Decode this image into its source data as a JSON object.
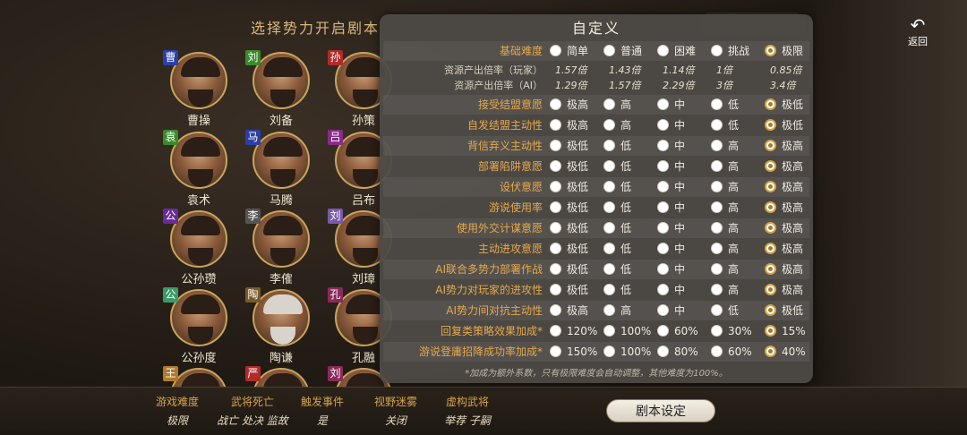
{
  "screen": {
    "title": "选择势力开启剧本",
    "back_label": "返回",
    "back_icon": "undo-arrow-icon"
  },
  "characters": [
    {
      "badge": "曹",
      "badge_color": "#2b3fa8",
      "name": "曹操",
      "hair": "dark"
    },
    {
      "badge": "刘",
      "badge_color": "#3a8a2a",
      "name": "刘备",
      "hair": "dark"
    },
    {
      "badge": "孙",
      "badge_color": "#b02a2a",
      "name": "孙策",
      "hair": "dark"
    },
    {
      "badge": "袁",
      "badge_color": "#3a8a2a",
      "name": "袁术",
      "hair": "dark"
    },
    {
      "badge": "马",
      "badge_color": "#2b3fa8",
      "name": "马腾",
      "hair": "dark"
    },
    {
      "badge": "吕",
      "badge_color": "#8a2a8a",
      "name": "吕布",
      "hair": "dark"
    },
    {
      "badge": "公",
      "badge_color": "#6a2a9a",
      "name": "公孙瓒",
      "hair": "dark"
    },
    {
      "badge": "李",
      "badge_color": "#555555",
      "name": "李傕",
      "hair": "dark"
    },
    {
      "badge": "刘",
      "badge_color": "#7a5aa8",
      "name": "刘璋",
      "hair": "dark"
    },
    {
      "badge": "公",
      "badge_color": "#3a9a6a",
      "name": "公孙度",
      "hair": "dark"
    },
    {
      "badge": "陶",
      "badge_color": "#7a5a2a",
      "name": "陶谦",
      "hair": "grey"
    },
    {
      "badge": "孔",
      "badge_color": "#8a2a5a",
      "name": "孔融",
      "hair": "dark"
    },
    {
      "badge": "王",
      "badge_color": "#b07a2a",
      "name": "",
      "hair": "dark"
    },
    {
      "badge": "严",
      "badge_color": "#b02a2a",
      "name": "",
      "hair": "dark"
    },
    {
      "badge": "刘",
      "badge_color": "#8a2a5a",
      "name": "",
      "hair": "dark"
    }
  ],
  "bottom_bar": {
    "stats": [
      {
        "label": "游戏难度",
        "value": "极限"
      },
      {
        "label": "武将死亡",
        "value": "战亡 处决 监故"
      },
      {
        "label": "触发事件",
        "value": "是"
      },
      {
        "label": "视野迷雾",
        "value": "关闭"
      },
      {
        "label": "虚构武将",
        "value": "举荐 子嗣"
      }
    ],
    "script_button": "剧本设定"
  },
  "modal": {
    "title": "自定义",
    "difficulty": {
      "label": "基础难度",
      "options": [
        "简单",
        "普通",
        "困难",
        "挑战",
        "极限"
      ],
      "selected": 4
    },
    "rates": [
      {
        "label": "资源产出倍率（玩家）",
        "values": [
          "1.57倍",
          "1.43倍",
          "1.14倍",
          "1倍",
          "0.85倍"
        ]
      },
      {
        "label": "资源产出倍率（AI）",
        "values": [
          "1.29倍",
          "1.57倍",
          "2.29倍",
          "3倍",
          "3.4倍"
        ]
      }
    ],
    "settings": [
      {
        "label": "接受结盟意愿",
        "options": [
          "极高",
          "高",
          "中",
          "低",
          "极低"
        ],
        "selected": 4
      },
      {
        "label": "自发结盟主动性",
        "options": [
          "极高",
          "高",
          "中",
          "低",
          "极低"
        ],
        "selected": 4
      },
      {
        "label": "背信弃义主动性",
        "options": [
          "极低",
          "低",
          "中",
          "高",
          "极高"
        ],
        "selected": 4
      },
      {
        "label": "部署陷阱意愿",
        "options": [
          "极低",
          "低",
          "中",
          "高",
          "极高"
        ],
        "selected": 4
      },
      {
        "label": "设伏意愿",
        "options": [
          "极低",
          "低",
          "中",
          "高",
          "极高"
        ],
        "selected": 4
      },
      {
        "label": "游说使用率",
        "options": [
          "极低",
          "低",
          "中",
          "高",
          "极高"
        ],
        "selected": 4
      },
      {
        "label": "使用外交计谋意愿",
        "options": [
          "极低",
          "低",
          "中",
          "高",
          "极高"
        ],
        "selected": 4
      },
      {
        "label": "主动进攻意愿",
        "options": [
          "极低",
          "低",
          "中",
          "高",
          "极高"
        ],
        "selected": 4
      },
      {
        "label": "AI联合多势力部署作战",
        "options": [
          "极低",
          "低",
          "中",
          "高",
          "极高"
        ],
        "selected": 4
      },
      {
        "label": "AI势力对玩家的进攻性",
        "options": [
          "极低",
          "低",
          "中",
          "高",
          "极高"
        ],
        "selected": 4
      },
      {
        "label": "AI势力间对抗主动性",
        "options": [
          "极高",
          "高",
          "中",
          "低",
          "极低"
        ],
        "selected": 4
      },
      {
        "label": "回复类策略效果加成*",
        "options": [
          "120%",
          "100%",
          "60%",
          "30%",
          "15%"
        ],
        "selected": 4
      },
      {
        "label": "游说登庸招降成功率加成*",
        "options": [
          "150%",
          "100%",
          "80%",
          "60%",
          "40%"
        ],
        "selected": 4
      }
    ],
    "footnote": "*加成为额外系数，只有极限难度会自动调整，其他难度为100%。"
  }
}
